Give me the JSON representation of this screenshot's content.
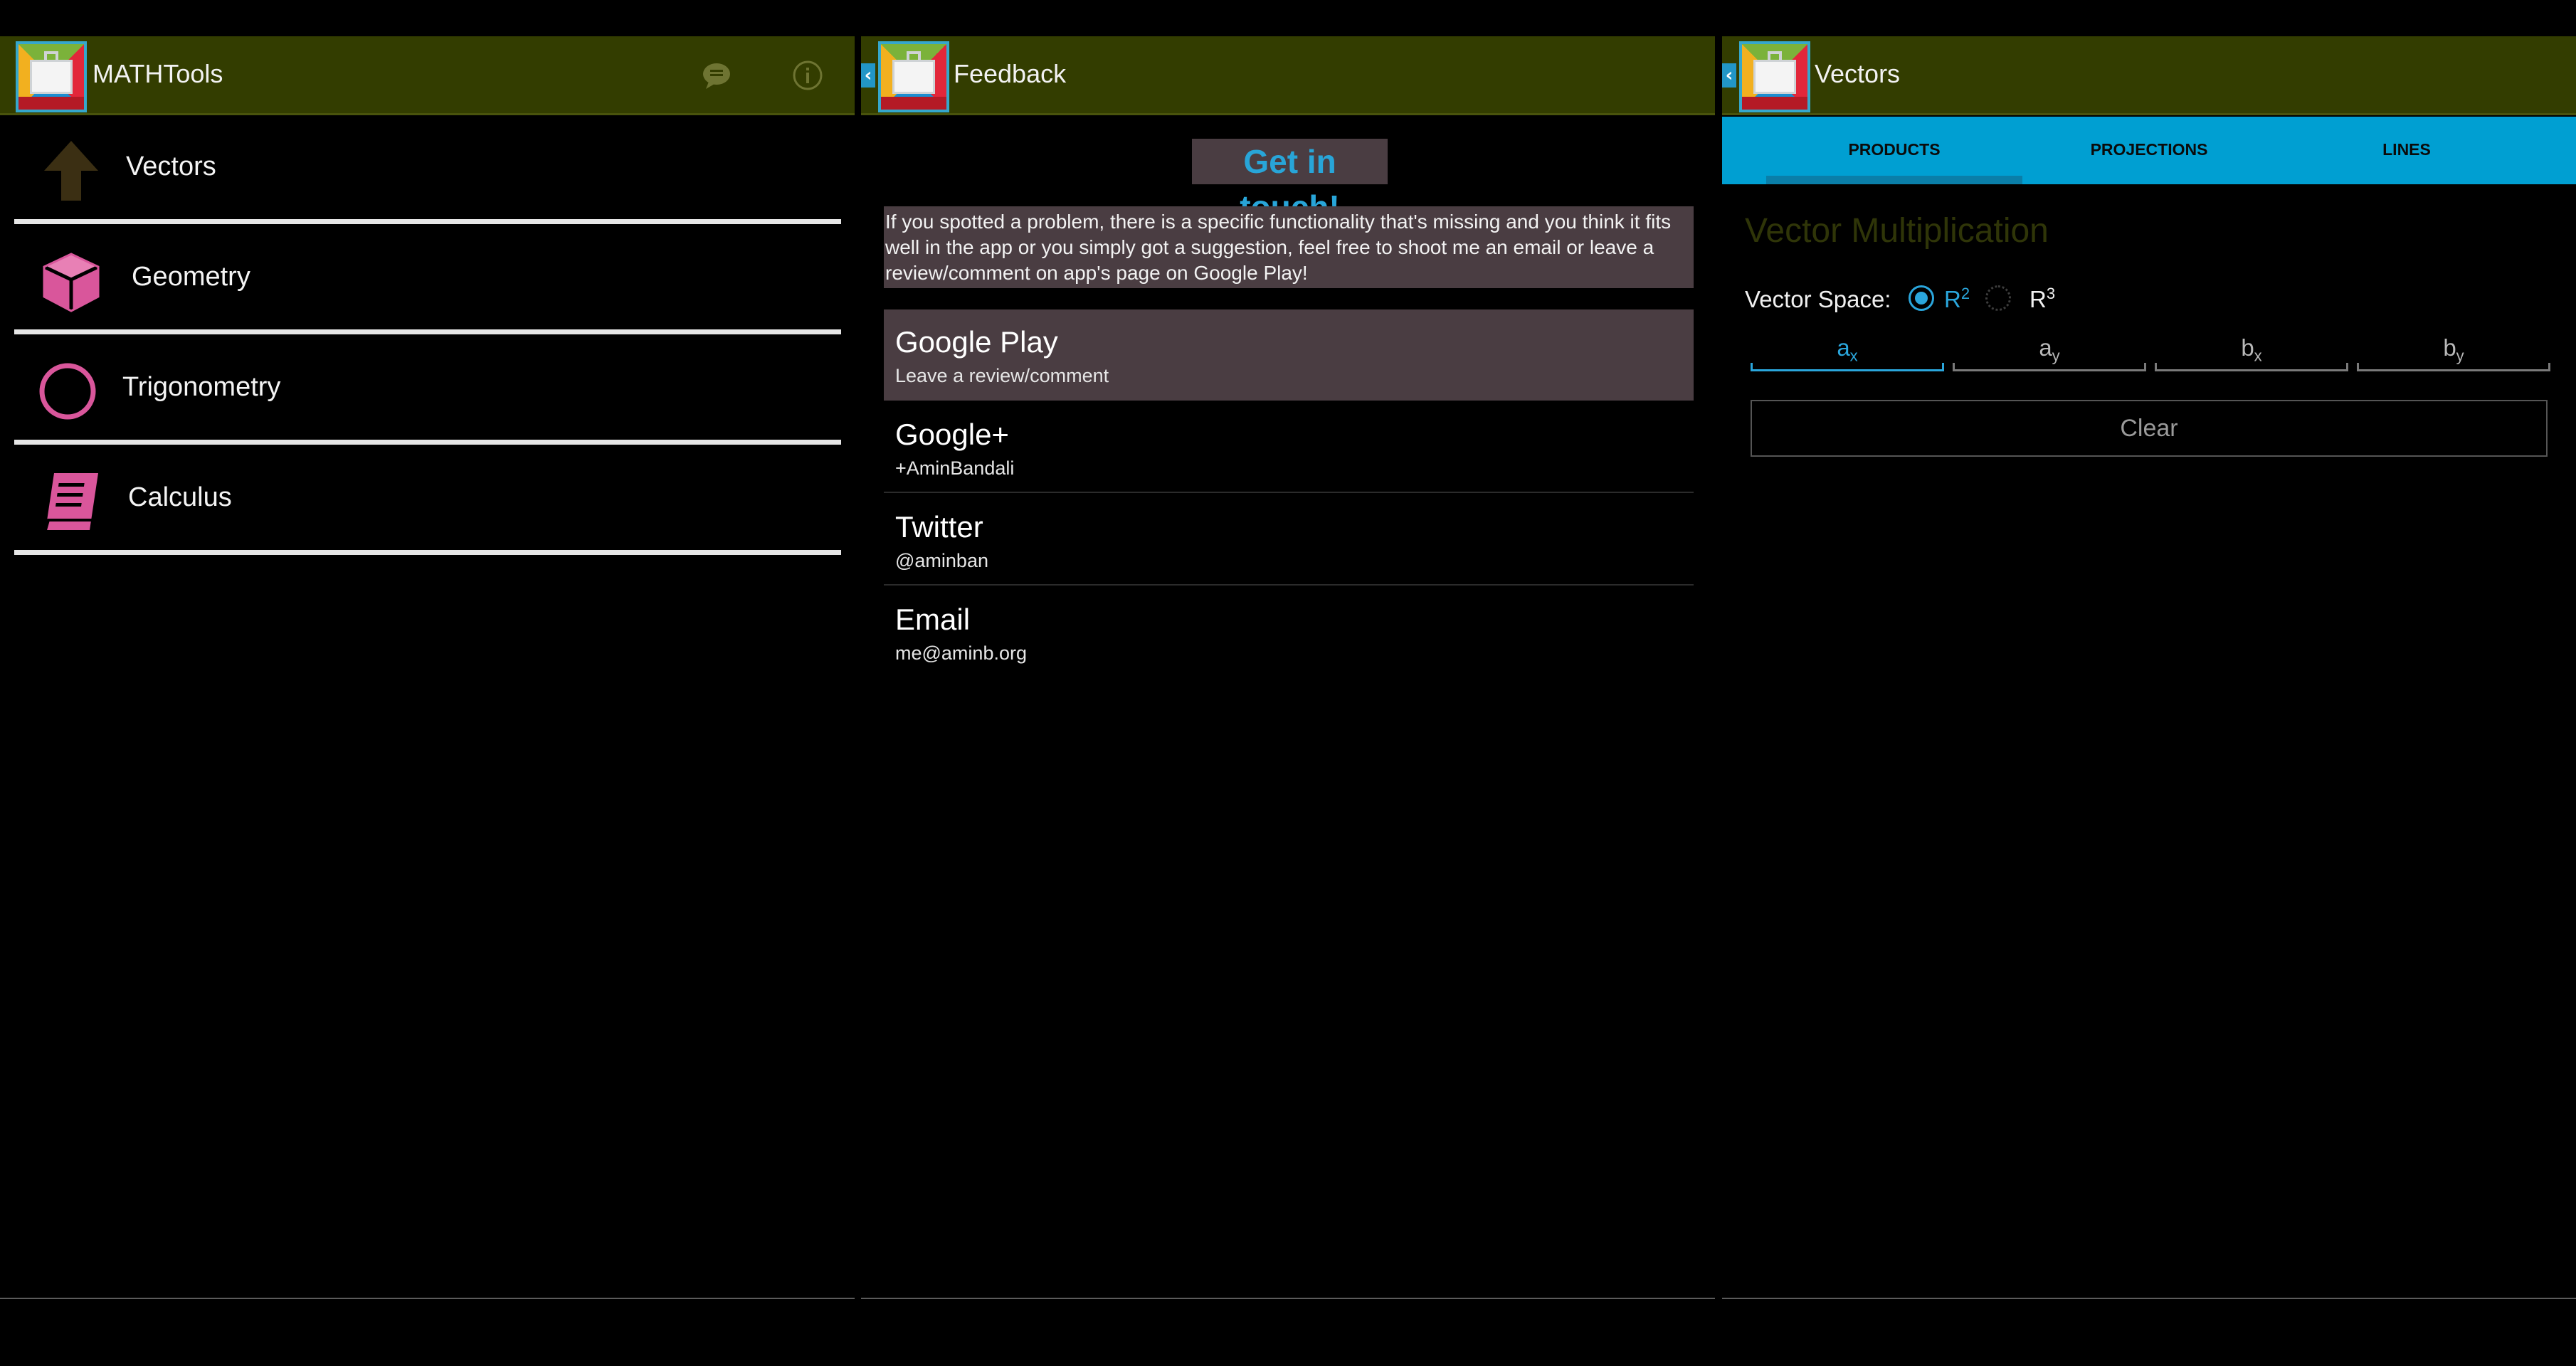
{
  "screen1": {
    "title": "MATHTools",
    "icons": [
      "feedback-icon",
      "info-icon"
    ],
    "menu": [
      {
        "label": "Vectors",
        "icon": "up-arrow-icon"
      },
      {
        "label": "Geometry",
        "icon": "cube-icon"
      },
      {
        "label": "Trigonometry",
        "icon": "circle-icon"
      },
      {
        "label": "Calculus",
        "icon": "book-icon"
      }
    ]
  },
  "screen2": {
    "title": "Feedback",
    "heading": "Get in touch!",
    "intro": "If you spotted a problem, there is a specific functionality that's missing and you think it fits well in the app or you simply got a suggestion, feel free to shoot me an email or leave a review/comment on app's page on Google Play!",
    "contacts": [
      {
        "title": "Google Play",
        "sub": "Leave a review/comment"
      },
      {
        "title": "Google+",
        "sub": "+AminBandali"
      },
      {
        "title": "Twitter",
        "sub": "@aminban"
      },
      {
        "title": "Email",
        "sub": "me@aminb.org"
      }
    ]
  },
  "screen3": {
    "title": "Vectors",
    "tabs": [
      "PRODUCTS",
      "PROJECTIONS",
      "LINES"
    ],
    "selected_tab": "PRODUCTS",
    "section_title": "Vector Multiplication",
    "vector_space_label": "Vector Space:",
    "options": [
      {
        "base": "R",
        "exp": "2",
        "selected": true
      },
      {
        "base": "R",
        "exp": "3",
        "selected": false
      }
    ],
    "fields": [
      {
        "base": "a",
        "sub": "x"
      },
      {
        "base": "a",
        "sub": "y"
      },
      {
        "base": "b",
        "sub": "x"
      },
      {
        "base": "b",
        "sub": "y"
      }
    ],
    "clear_label": "Clear"
  },
  "colors": {
    "actionbar": "#333d00",
    "accent": "#009fd2",
    "highlight": "#4a3d42",
    "pink": "#d9569b",
    "brown": "#3b2f13"
  }
}
